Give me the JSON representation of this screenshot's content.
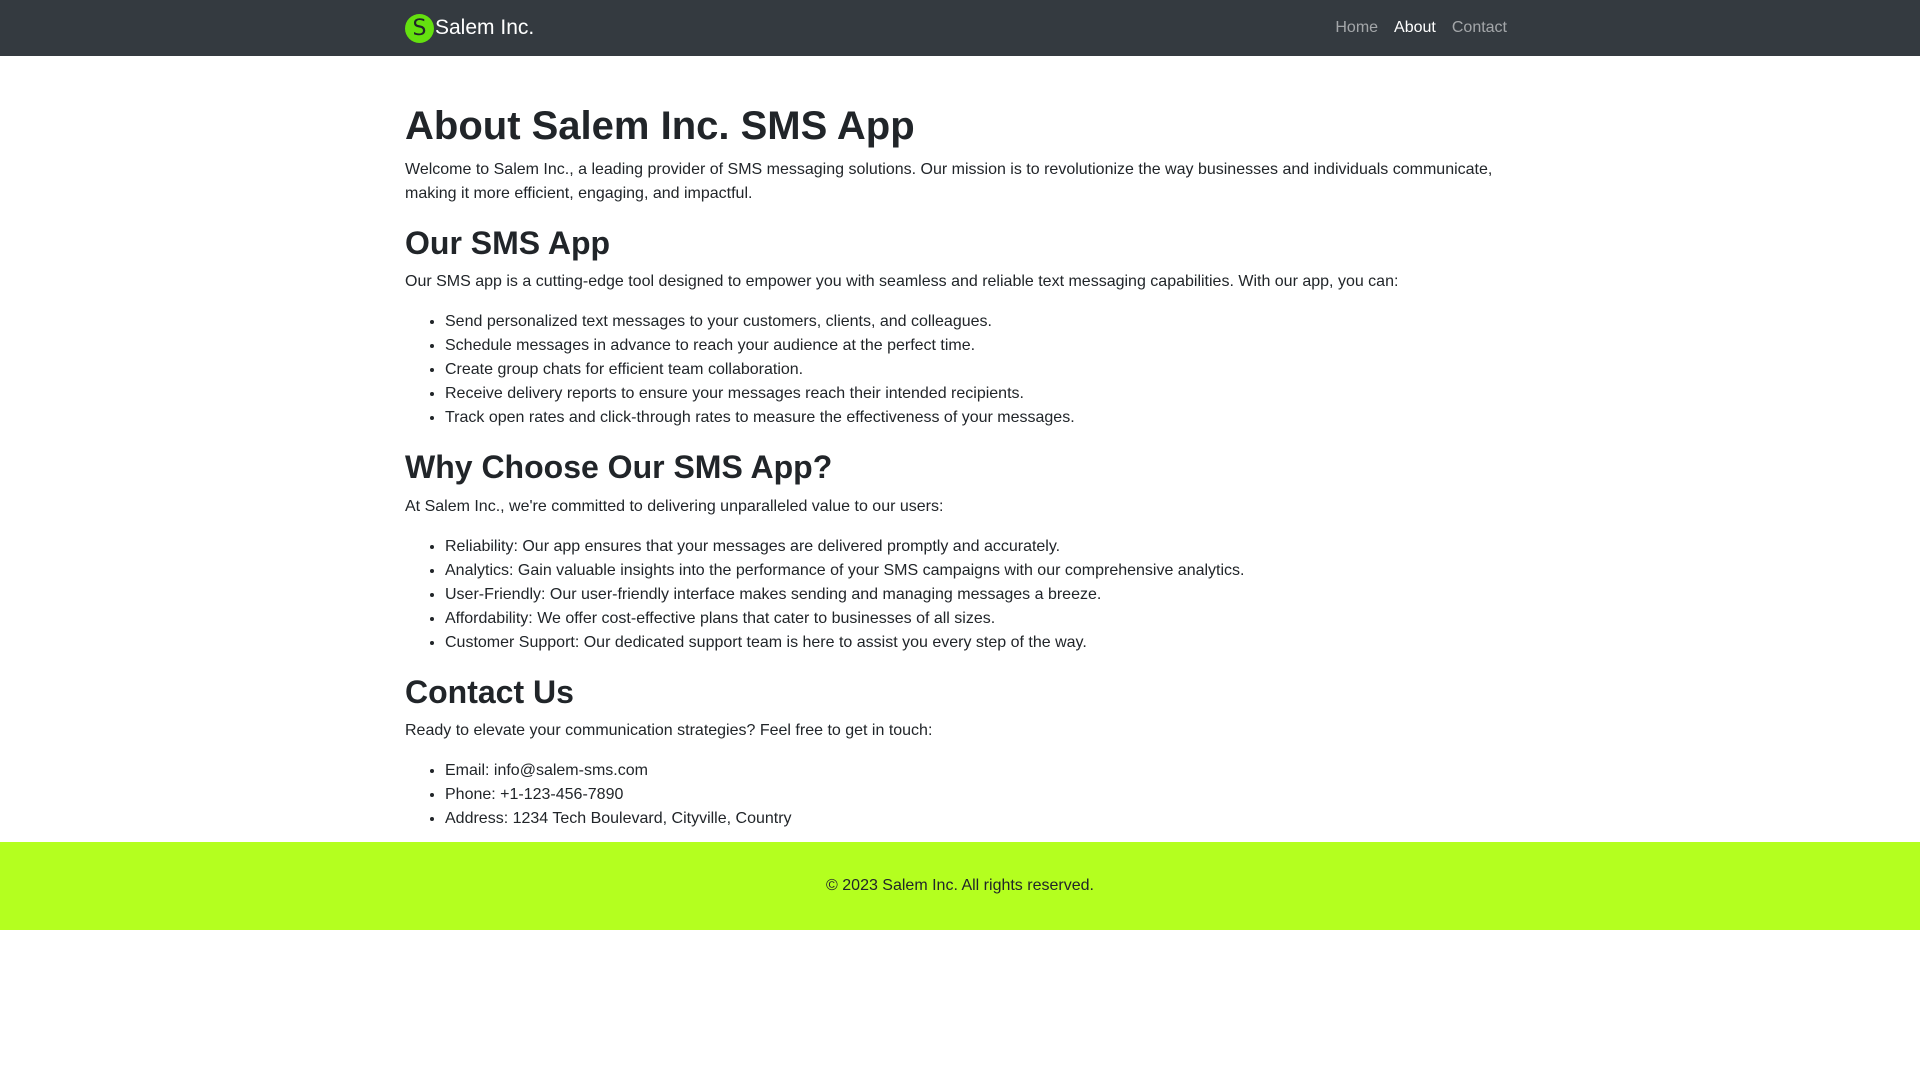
{
  "navbar": {
    "logo_letter": "S",
    "brand": "Salem Inc.",
    "links": [
      {
        "label": "Home",
        "active": false
      },
      {
        "label": "About",
        "active": true
      },
      {
        "label": "Contact",
        "active": false
      }
    ]
  },
  "main": {
    "title": "About Salem Inc. SMS App",
    "intro": "Welcome to Salem Inc., a leading provider of SMS messaging solutions. Our mission is to revolutionize the way businesses and individuals communicate, making it more efficient, engaging, and impactful.",
    "app_section": {
      "heading": "Our SMS App",
      "text": "Our SMS app is a cutting-edge tool designed to empower you with seamless and reliable text messaging capabilities. With our app, you can:",
      "items": [
        "Send personalized text messages to your customers, clients, and colleagues.",
        "Schedule messages in advance to reach your audience at the perfect time.",
        "Create group chats for efficient team collaboration.",
        "Receive delivery reports to ensure your messages reach their intended recipients.",
        "Track open rates and click-through rates to measure the effectiveness of your messages."
      ]
    },
    "why_section": {
      "heading": "Why Choose Our SMS App?",
      "text": "At Salem Inc., we're committed to delivering unparalleled value to our users:",
      "items": [
        "Reliability: Our app ensures that your messages are delivered promptly and accurately.",
        "Analytics: Gain valuable insights into the performance of your SMS campaigns with our comprehensive analytics.",
        "User-Friendly: Our user-friendly interface makes sending and managing messages a breeze.",
        "Affordability: We offer cost-effective plans that cater to businesses of all sizes.",
        "Customer Support: Our dedicated support team is here to assist you every step of the way."
      ]
    },
    "contact_section": {
      "heading": "Contact Us",
      "text": "Ready to elevate your communication strategies? Feel free to get in touch:",
      "items": [
        "Email: info@salem-sms.com",
        "Phone: +1-123-456-7890",
        "Address: 1234 Tech Boulevard, Cityville, Country"
      ]
    }
  },
  "footer": {
    "copyright": "© 2023 Salem Inc. All rights reserved."
  },
  "colors": {
    "navbar_bg": "#343a40",
    "logo_bg": "#64e00f",
    "footer_bg": "#b4ff1f"
  }
}
